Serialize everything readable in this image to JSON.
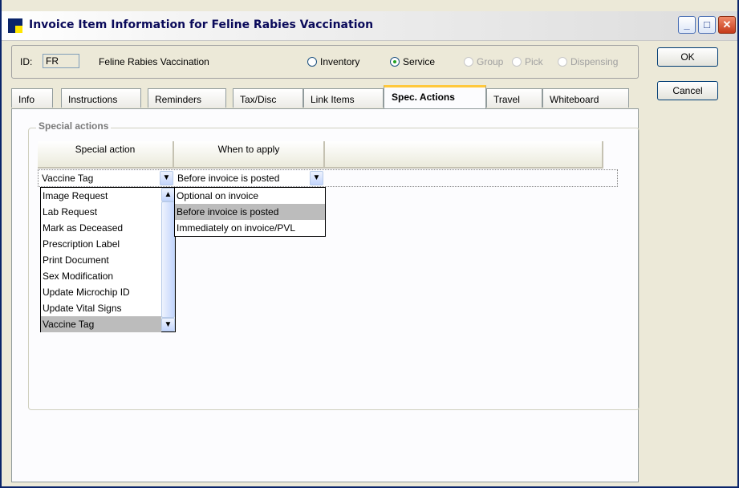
{
  "window": {
    "title": "Invoice Item Information for Feline Rabies Vaccination"
  },
  "header": {
    "id_label": "ID:",
    "id_value": "FR",
    "item_name": "Feline Rabies Vaccination",
    "item_types": [
      {
        "label": "Inventory",
        "selected": false,
        "enabled": true
      },
      {
        "label": "Service",
        "selected": true,
        "enabled": true
      },
      {
        "label": "Group",
        "selected": false,
        "enabled": false
      },
      {
        "label": "Pick",
        "selected": false,
        "enabled": false
      },
      {
        "label": "Dispensing",
        "selected": false,
        "enabled": false
      }
    ]
  },
  "buttons": {
    "ok": "OK",
    "cancel": "Cancel"
  },
  "tabs": [
    {
      "label": "Info"
    },
    {
      "label": "Instructions"
    },
    {
      "label": "Reminders"
    },
    {
      "label": "Tax/Disc"
    },
    {
      "label": "Link Items"
    },
    {
      "label": "Spec. Actions",
      "active": true
    },
    {
      "label": "Travel"
    },
    {
      "label": "Whiteboard"
    }
  ],
  "special_actions": {
    "group_label": "Special actions",
    "columns": [
      "Special action",
      "When to apply"
    ],
    "row": {
      "special_action": "Vaccine Tag",
      "when_to_apply": "Before invoice is posted"
    },
    "action_options": [
      "Image Request",
      "Lab Request",
      "Mark as Deceased",
      "Prescription Label",
      "Print Document",
      "Sex Modification",
      "Update Microchip ID",
      "Update Vital Signs",
      "Vaccine Tag"
    ],
    "action_selected": "Vaccine Tag",
    "when_options": [
      "Optional on invoice",
      "Before invoice is posted",
      "Immediately on invoice/PVL"
    ],
    "when_selected": "Before invoice is posted"
  }
}
